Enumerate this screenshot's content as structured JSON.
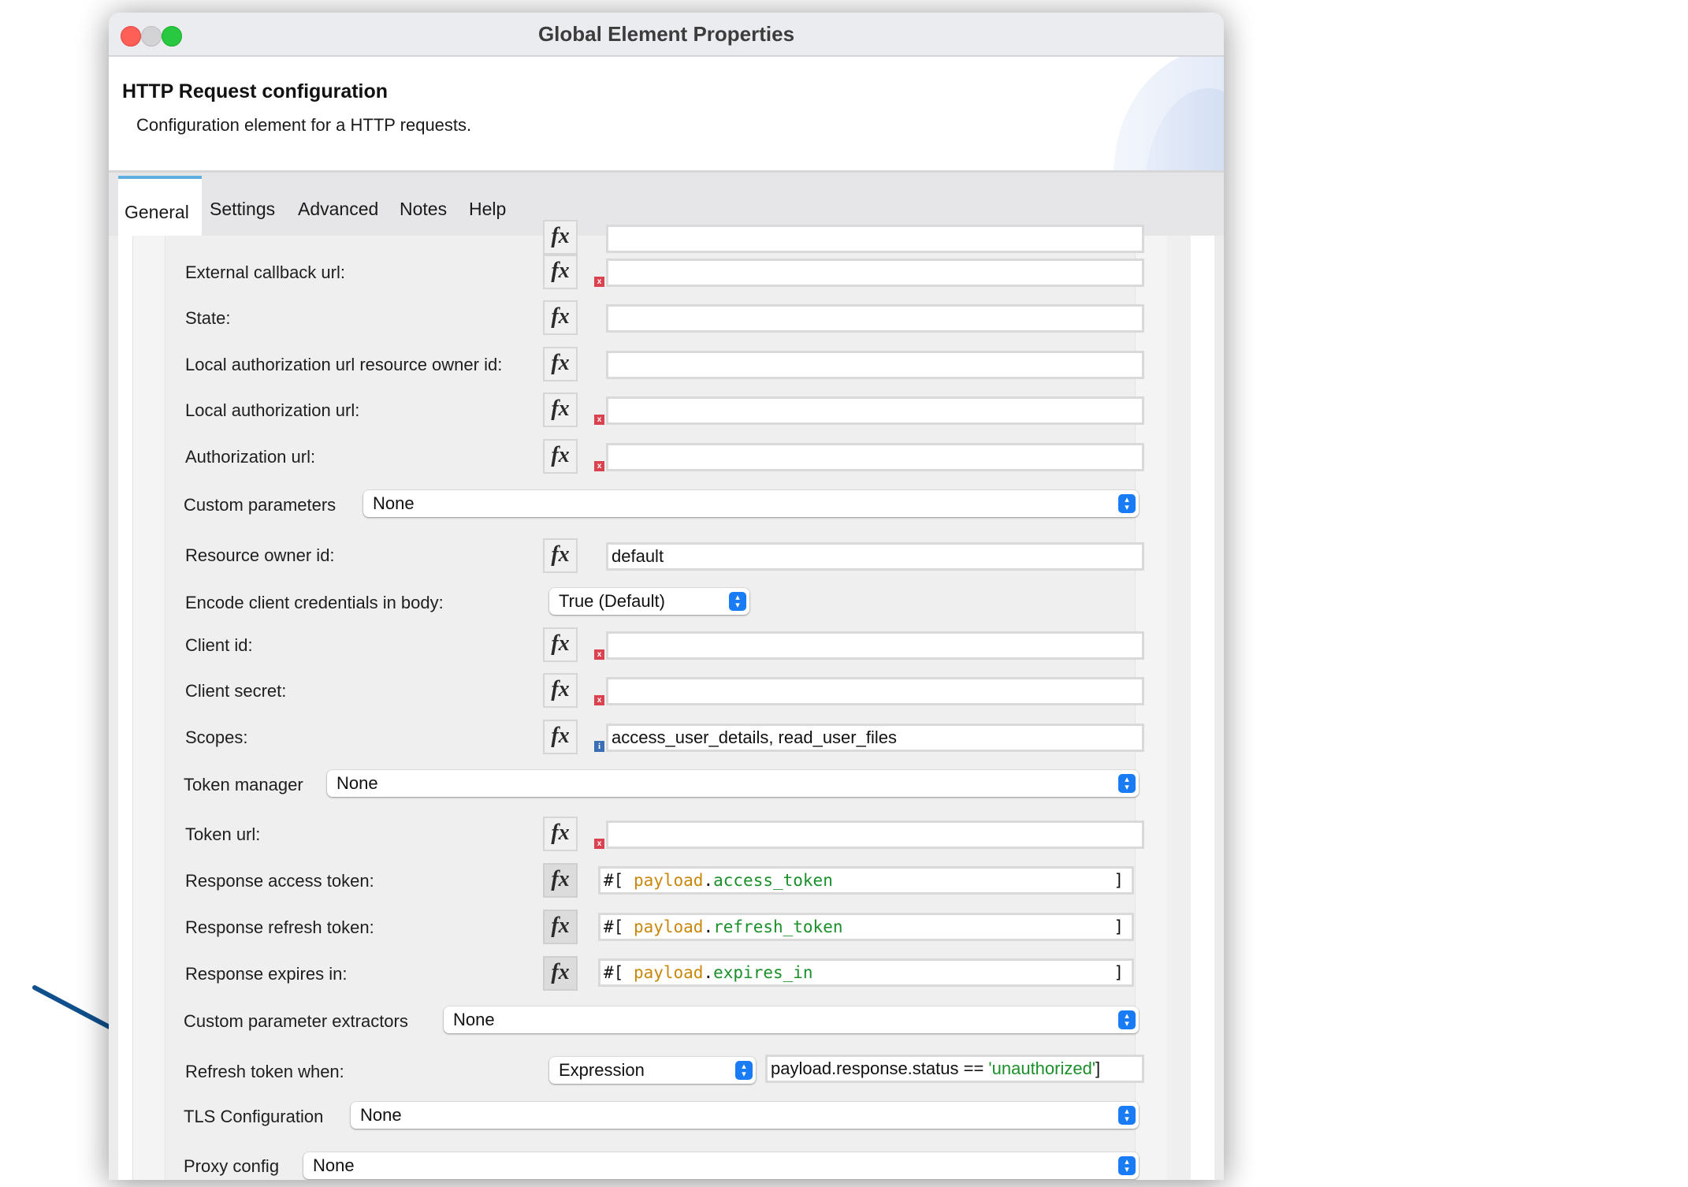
{
  "window": {
    "title": "Global Element Properties",
    "controls": [
      "close",
      "minimize",
      "zoom"
    ]
  },
  "header": {
    "title": "HTTP Request configuration",
    "description": "Configuration element for a HTTP requests."
  },
  "tabs": [
    {
      "label": "General",
      "active": true
    },
    {
      "label": "Settings",
      "active": false
    },
    {
      "label": "Advanced",
      "active": false
    },
    {
      "label": "Notes",
      "active": false
    },
    {
      "label": "Help",
      "active": false
    }
  ],
  "icons": {
    "fx": "fx",
    "error": "x",
    "info": "i",
    "stepper": "⌃⌄"
  },
  "form": {
    "external_callback_url": {
      "label": "External callback url:",
      "value": "",
      "required": true
    },
    "state": {
      "label": "State:",
      "value": ""
    },
    "local_auth_url_owner_id": {
      "label": "Local authorization url resource owner id:",
      "value": ""
    },
    "local_auth_url": {
      "label": "Local authorization url:",
      "value": "",
      "required": true
    },
    "authorization_url": {
      "label": "Authorization url:",
      "value": "",
      "required": true
    },
    "custom_parameters": {
      "label": "Custom parameters",
      "value": "None"
    },
    "resource_owner_id": {
      "label": "Resource owner id:",
      "value": "default"
    },
    "encode_client_credentials": {
      "label": "Encode client credentials in body:",
      "value": "True (Default)"
    },
    "client_id": {
      "label": "Client id:",
      "value": "",
      "required": true
    },
    "client_secret": {
      "label": "Client secret:",
      "value": "",
      "required": true
    },
    "scopes": {
      "label": "Scopes:",
      "value": "access_user_details, read_user_files"
    },
    "token_manager": {
      "label": "Token manager",
      "value": "None"
    },
    "token_url": {
      "label": "Token url:",
      "value": "",
      "required": true
    },
    "response_access_token": {
      "label": "Response access token:",
      "prefix": "#[",
      "obj": "payload",
      "dot": ".",
      "field": "access_token",
      "suffix": "]"
    },
    "response_refresh_token": {
      "label": "Response refresh token:",
      "prefix": "#[",
      "obj": "payload",
      "dot": ".",
      "field": "refresh_token",
      "suffix": "]"
    },
    "response_expires_in": {
      "label": "Response expires in:",
      "prefix": "#[",
      "obj": "payload",
      "dot": ".",
      "field": "expires_in",
      "suffix": "]"
    },
    "custom_parameter_extractors": {
      "label": "Custom parameter extractors",
      "value": "None"
    },
    "refresh_token_when": {
      "label": "Refresh token when:",
      "mode": "Expression",
      "expr_text": "payload.response.status == ",
      "expr_string": "'unauthorized'",
      "expr_end": "]"
    },
    "tls_configuration": {
      "label": "TLS Configuration",
      "value": "None"
    },
    "proxy_config": {
      "label": "Proxy config",
      "value": "None"
    }
  },
  "annotation": {
    "type": "arrow",
    "color": "#0f4f8c",
    "points_to": "Refresh token when:"
  }
}
